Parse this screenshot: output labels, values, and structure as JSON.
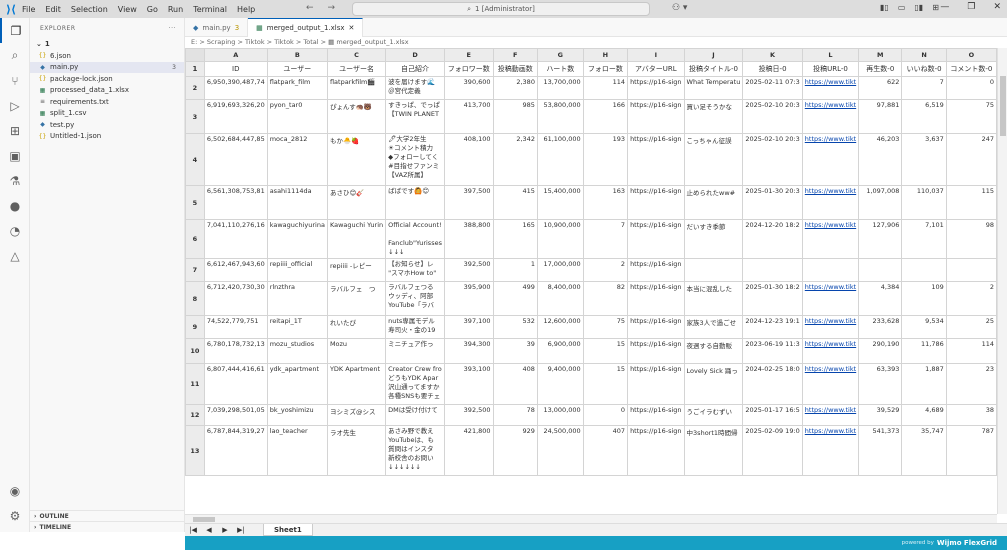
{
  "menu": [
    "File",
    "Edit",
    "Selection",
    "View",
    "Go",
    "Run",
    "Terminal",
    "Help"
  ],
  "nav": {
    "back": "←",
    "forward": "→"
  },
  "command_center": "1 [Administrator]",
  "window_controls": {
    "minimize": "—",
    "maximize": "❐",
    "close": "✕"
  },
  "explorer": {
    "title": "EXPLORER",
    "more": "···",
    "root": "1",
    "files": [
      {
        "name": "6.json",
        "icon": "{}",
        "color": "#c9a100"
      },
      {
        "name": "main.py",
        "icon": "◆",
        "color": "#3572a5",
        "active": true,
        "badge": "3"
      },
      {
        "name": "package-lock.json",
        "icon": "{}",
        "color": "#c9a100"
      },
      {
        "name": "processed_data_1.xlsx",
        "icon": "▦",
        "color": "#217346"
      },
      {
        "name": "requirements.txt",
        "icon": "≡",
        "color": "#555555"
      },
      {
        "name": "split_1.csv",
        "icon": "▦",
        "color": "#217346"
      },
      {
        "name": "test.py",
        "icon": "◆",
        "color": "#3572a5"
      },
      {
        "name": "Untitled-1.json",
        "icon": "{}",
        "color": "#c9a100"
      }
    ],
    "outline": "OUTLINE",
    "timeline": "TIMELINE"
  },
  "tabs": [
    {
      "label": "main.py",
      "badge": "3",
      "icon": "◆",
      "active": false
    },
    {
      "label": "merged_output_1.xlsx",
      "icon": "▦",
      "active": true,
      "close": "✕"
    }
  ],
  "breadcrumb": "E: > Scraping > Tiktok > Tiktok > Total > ▦ merged_output_1.xlsx",
  "grid": {
    "columns": [
      "A",
      "B",
      "C",
      "D",
      "E",
      "F",
      "G",
      "H",
      "I",
      "J",
      "K",
      "L",
      "M",
      "N",
      "O"
    ],
    "header_row": [
      "ID",
      "ユーザー",
      "ユーザー名",
      "自己紹介",
      "フォロワー数",
      "投稿動画数",
      "ハート数",
      "フォロー数",
      "アバターURL",
      "投稿タイトル-0",
      "投稿日-0",
      "投稿URL-0",
      "再生数-0",
      "いいね数-0",
      "コメント数-0"
    ],
    "rows": [
      {
        "n": "2",
        "cells": [
          "6,950,390,487,74",
          "flatpark_film",
          "flatparkfilm🎬",
          "波を届けます🌊\n＠宮代定義",
          "390,600",
          "2,380",
          "13,700,000",
          "114",
          "https://p16-sign",
          "What Temperatu",
          "2025-02-11 07:3",
          "https://www.tikt",
          "622",
          "7",
          "0"
        ]
      },
      {
        "n": "3",
        "cells": [
          "6,919,693,326,20",
          "pyon_tar0",
          "ぴょんす🦔🐻",
          "すきっぱ、でっぱ\n【TWIN PLANET",
          "413,700",
          "985",
          "53,800,000",
          "166",
          "https://p16-sign",
          "買い足そうかな",
          "2025-02-10 20:3",
          "https://www.tikt",
          "97,881",
          "6,519",
          "75"
        ]
      },
      {
        "n": "4",
        "cells": [
          "6,502,684,447,85",
          "moca_2812",
          "もか🐣🍓",
          "🖊大学2年生\n☀コメント積力\n◆フォローしてく\n#目指せファンミ\n【VAZ所属】",
          "408,100",
          "2,342",
          "61,100,000",
          "193",
          "https://p16-sign",
          "こっちゃん征誤",
          "2025-02-10 20:3",
          "https://www.tikt",
          "46,203",
          "3,637",
          "247"
        ]
      },
      {
        "n": "5",
        "cells": [
          "6,561,308,753,81",
          "asahi1114da",
          "あさひ😊🎸",
          "ばばです🙆😊",
          "397,500",
          "415",
          "15,400,000",
          "163",
          "https://p16-sign",
          "止められたww#",
          "2025-01-30 20:3",
          "https://www.tikt",
          "1,097,008",
          "110,037",
          "115"
        ]
      },
      {
        "n": "6",
        "cells": [
          "7,041,110,276,16",
          "kawaguchiyurina",
          "Kawaguchi Yurin",
          "Official Account!\n\nFanclub\"Yurisses\n↓↓↓",
          "388,800",
          "165",
          "10,900,000",
          "7",
          "https://p16-sign",
          "だいすき季節",
          "2024-12-20 18:2",
          "https://www.tikt",
          "127,906",
          "7,101",
          "98"
        ]
      },
      {
        "n": "7",
        "cells": [
          "6,612,467,943,60",
          "repiiii_official",
          "repiiii -レピー",
          "【お知らせ】レ\n\"スマホHow to\"",
          "392,500",
          "1",
          "17,000,000",
          "2",
          "https://p16-sign",
          "",
          "",
          "",
          "",
          "",
          ""
        ]
      },
      {
        "n": "8",
        "cells": [
          "6,712,420,730,30",
          "rlnzthra",
          "ラバルフェ　つ",
          "ラバルフェつる\nウッディ、阿部\nYouTube「ラバ",
          "395,900",
          "499",
          "8,400,000",
          "82",
          "https://p16-sign",
          "本当に混乱した",
          "2025-01-30 18:2",
          "https://www.tikt",
          "4,384",
          "109",
          "2"
        ]
      },
      {
        "n": "9",
        "cells": [
          "74,522,779,751",
          "reitapi_1T",
          "れいたぴ",
          "nuts専属モデル\n寿司火・金の19",
          "397,100",
          "532",
          "12,600,000",
          "75",
          "https://p16-sign",
          "家族3人で過ごせ",
          "2024-12-23 19:1",
          "https://www.tikt",
          "233,628",
          "9,534",
          "25"
        ]
      },
      {
        "n": "10",
        "cells": [
          "6,780,178,732,13",
          "mozu_studios",
          "Mozu",
          "ミニチュア作っ",
          "394,300",
          "39",
          "6,900,000",
          "15",
          "https://p16-sign",
          "夜週する自動販",
          "2023-06-19 11:3",
          "https://www.tikt",
          "290,190",
          "11,786",
          "114"
        ]
      },
      {
        "n": "11",
        "cells": [
          "6,807,444,416,61",
          "ydk_apartment",
          "YDK Apartment",
          "Creator Crew fro\nどうもYDK Apar\n沢山通ってますか\n各種SNSも要チェ",
          "393,100",
          "408",
          "9,400,000",
          "15",
          "https://p16-sign",
          "Lovely Sick 踊っ",
          "2024-02-25 18:0",
          "https://www.tikt",
          "63,393",
          "1,887",
          "23"
        ]
      },
      {
        "n": "12",
        "cells": [
          "7,039,298,501,05",
          "bk_yoshimizu",
          "ヨシミズ@シス",
          "DMは受け付けて",
          "392,500",
          "78",
          "13,000,000",
          "0",
          "https://p16-sign",
          "うごイラむずい",
          "2025-01-17 16:5",
          "https://www.tikt",
          "39,529",
          "4,689",
          "38"
        ]
      },
      {
        "n": "13",
        "cells": [
          "6,787,844,319,27",
          "lao_teacher",
          "ラオ先生",
          "あさみ野で教え\nYouTubeは、も\n質問はインスタ\n新校舎のお問い\n↓↓↓↓↓↓",
          "421,800",
          "929",
          "24,500,000",
          "407",
          "https://p16-sign",
          "中3short1時間帰",
          "2025-02-09 19:0",
          "https://www.tikt",
          "541,373",
          "35,747",
          "787"
        ]
      }
    ]
  },
  "sheet": {
    "nav": [
      "|◀",
      "◀",
      "▶",
      "▶|"
    ],
    "name": "Sheet1"
  },
  "status": {
    "powered": "powered by",
    "brand": "Wijmo FlexGrid"
  }
}
